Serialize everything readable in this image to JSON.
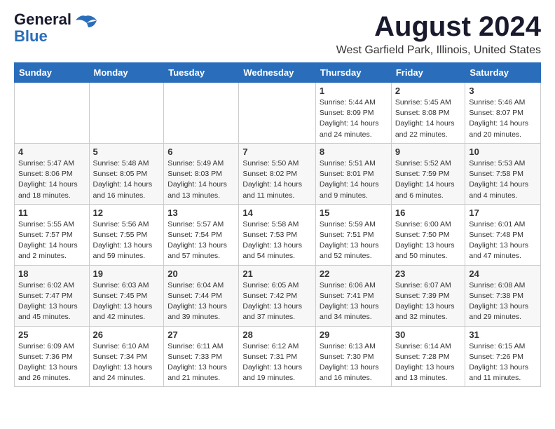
{
  "logo": {
    "line1": "General",
    "line2": "Blue"
  },
  "title": "August 2024",
  "subtitle": "West Garfield Park, Illinois, United States",
  "weekdays": [
    "Sunday",
    "Monday",
    "Tuesday",
    "Wednesday",
    "Thursday",
    "Friday",
    "Saturday"
  ],
  "weeks": [
    [
      {
        "day": "",
        "info": ""
      },
      {
        "day": "",
        "info": ""
      },
      {
        "day": "",
        "info": ""
      },
      {
        "day": "",
        "info": ""
      },
      {
        "day": "1",
        "info": "Sunrise: 5:44 AM\nSunset: 8:09 PM\nDaylight: 14 hours and 24 minutes."
      },
      {
        "day": "2",
        "info": "Sunrise: 5:45 AM\nSunset: 8:08 PM\nDaylight: 14 hours and 22 minutes."
      },
      {
        "day": "3",
        "info": "Sunrise: 5:46 AM\nSunset: 8:07 PM\nDaylight: 14 hours and 20 minutes."
      }
    ],
    [
      {
        "day": "4",
        "info": "Sunrise: 5:47 AM\nSunset: 8:06 PM\nDaylight: 14 hours and 18 minutes."
      },
      {
        "day": "5",
        "info": "Sunrise: 5:48 AM\nSunset: 8:05 PM\nDaylight: 14 hours and 16 minutes."
      },
      {
        "day": "6",
        "info": "Sunrise: 5:49 AM\nSunset: 8:03 PM\nDaylight: 14 hours and 13 minutes."
      },
      {
        "day": "7",
        "info": "Sunrise: 5:50 AM\nSunset: 8:02 PM\nDaylight: 14 hours and 11 minutes."
      },
      {
        "day": "8",
        "info": "Sunrise: 5:51 AM\nSunset: 8:01 PM\nDaylight: 14 hours and 9 minutes."
      },
      {
        "day": "9",
        "info": "Sunrise: 5:52 AM\nSunset: 7:59 PM\nDaylight: 14 hours and 6 minutes."
      },
      {
        "day": "10",
        "info": "Sunrise: 5:53 AM\nSunset: 7:58 PM\nDaylight: 14 hours and 4 minutes."
      }
    ],
    [
      {
        "day": "11",
        "info": "Sunrise: 5:55 AM\nSunset: 7:57 PM\nDaylight: 14 hours and 2 minutes."
      },
      {
        "day": "12",
        "info": "Sunrise: 5:56 AM\nSunset: 7:55 PM\nDaylight: 13 hours and 59 minutes."
      },
      {
        "day": "13",
        "info": "Sunrise: 5:57 AM\nSunset: 7:54 PM\nDaylight: 13 hours and 57 minutes."
      },
      {
        "day": "14",
        "info": "Sunrise: 5:58 AM\nSunset: 7:53 PM\nDaylight: 13 hours and 54 minutes."
      },
      {
        "day": "15",
        "info": "Sunrise: 5:59 AM\nSunset: 7:51 PM\nDaylight: 13 hours and 52 minutes."
      },
      {
        "day": "16",
        "info": "Sunrise: 6:00 AM\nSunset: 7:50 PM\nDaylight: 13 hours and 50 minutes."
      },
      {
        "day": "17",
        "info": "Sunrise: 6:01 AM\nSunset: 7:48 PM\nDaylight: 13 hours and 47 minutes."
      }
    ],
    [
      {
        "day": "18",
        "info": "Sunrise: 6:02 AM\nSunset: 7:47 PM\nDaylight: 13 hours and 45 minutes."
      },
      {
        "day": "19",
        "info": "Sunrise: 6:03 AM\nSunset: 7:45 PM\nDaylight: 13 hours and 42 minutes."
      },
      {
        "day": "20",
        "info": "Sunrise: 6:04 AM\nSunset: 7:44 PM\nDaylight: 13 hours and 39 minutes."
      },
      {
        "day": "21",
        "info": "Sunrise: 6:05 AM\nSunset: 7:42 PM\nDaylight: 13 hours and 37 minutes."
      },
      {
        "day": "22",
        "info": "Sunrise: 6:06 AM\nSunset: 7:41 PM\nDaylight: 13 hours and 34 minutes."
      },
      {
        "day": "23",
        "info": "Sunrise: 6:07 AM\nSunset: 7:39 PM\nDaylight: 13 hours and 32 minutes."
      },
      {
        "day": "24",
        "info": "Sunrise: 6:08 AM\nSunset: 7:38 PM\nDaylight: 13 hours and 29 minutes."
      }
    ],
    [
      {
        "day": "25",
        "info": "Sunrise: 6:09 AM\nSunset: 7:36 PM\nDaylight: 13 hours and 26 minutes."
      },
      {
        "day": "26",
        "info": "Sunrise: 6:10 AM\nSunset: 7:34 PM\nDaylight: 13 hours and 24 minutes."
      },
      {
        "day": "27",
        "info": "Sunrise: 6:11 AM\nSunset: 7:33 PM\nDaylight: 13 hours and 21 minutes."
      },
      {
        "day": "28",
        "info": "Sunrise: 6:12 AM\nSunset: 7:31 PM\nDaylight: 13 hours and 19 minutes."
      },
      {
        "day": "29",
        "info": "Sunrise: 6:13 AM\nSunset: 7:30 PM\nDaylight: 13 hours and 16 minutes."
      },
      {
        "day": "30",
        "info": "Sunrise: 6:14 AM\nSunset: 7:28 PM\nDaylight: 13 hours and 13 minutes."
      },
      {
        "day": "31",
        "info": "Sunrise: 6:15 AM\nSunset: 7:26 PM\nDaylight: 13 hours and 11 minutes."
      }
    ]
  ]
}
